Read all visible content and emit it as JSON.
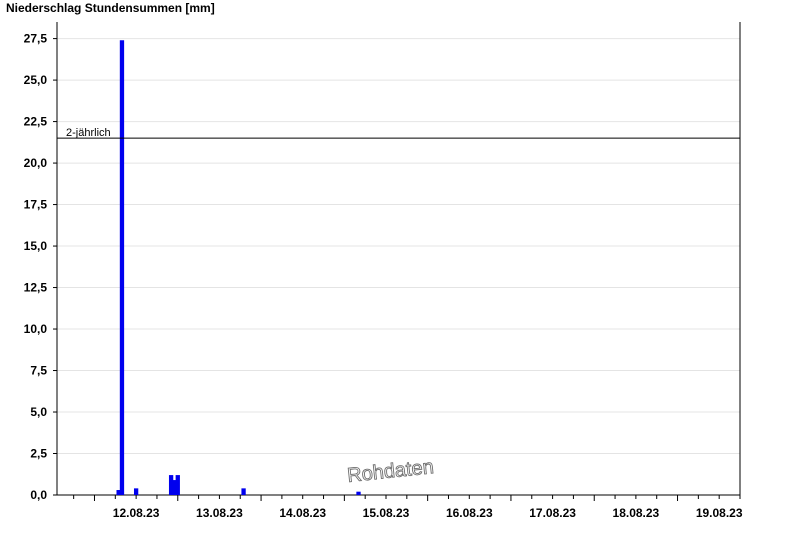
{
  "chart_data": {
    "type": "bar",
    "title": "Niederschlag Stundensummen [mm]",
    "xlabel": "",
    "ylabel": "",
    "ylim": [
      0,
      28.5
    ],
    "y_ticks": [
      "0,0",
      "2,5",
      "5,0",
      "7,5",
      "10,0",
      "12,5",
      "15,0",
      "17,5",
      "20,0",
      "22,5",
      "25,0",
      "27,5"
    ],
    "y_tick_values": [
      0,
      2.5,
      5,
      7.5,
      10,
      12.5,
      15,
      17.5,
      20,
      22.5,
      25,
      27.5
    ],
    "x_dates": [
      "12.08.23",
      "13.08.23",
      "14.08.23",
      "15.08.23",
      "16.08.23",
      "17.08.23",
      "18.08.23",
      "19.08.23"
    ],
    "x_range_days": [
      -0.45,
      7.75
    ],
    "grid": true,
    "bar_color": "#0000ee",
    "series": [
      {
        "points": [
          {
            "day": 0.29,
            "value": 0.3
          },
          {
            "day": 0.33,
            "value": 27.4
          },
          {
            "day": 0.5,
            "value": 0.4
          },
          {
            "day": 0.92,
            "value": 1.2
          },
          {
            "day": 0.96,
            "value": 0.9
          },
          {
            "day": 1.0,
            "value": 1.2
          },
          {
            "day": 1.79,
            "value": 0.4
          },
          {
            "day": 3.17,
            "value": 0.2
          }
        ]
      }
    ],
    "reference_line": {
      "label": "2-jährlich",
      "value": 21.5
    },
    "watermark": "Rohdaten"
  }
}
